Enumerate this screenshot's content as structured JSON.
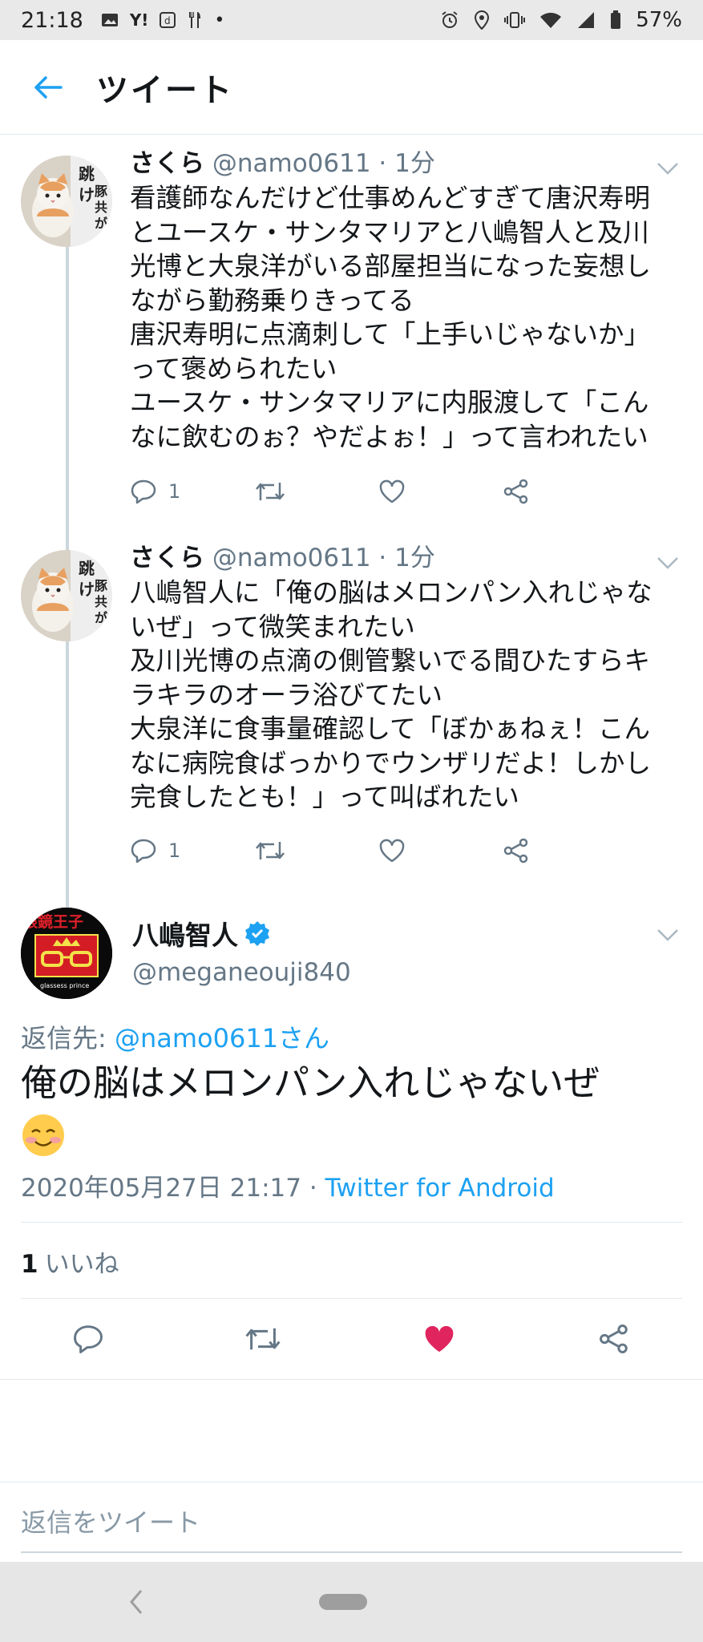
{
  "status_bar": {
    "time": "21:18",
    "battery": "57%"
  },
  "header": {
    "title": "ツイート"
  },
  "tweets": [
    {
      "name": "さくら",
      "handle": "@namo0611",
      "time": "· 1分",
      "text": "看護師なんだけど仕事めんどすぎて唐沢寿明\nとユースケ・サンタマリアと八嶋智人と及川\n光博と大泉洋がいる部屋担当になった妄想し\nながら勤務乗りきってる\n唐沢寿明に点滴刺して「上手いじゃないか」\nって褒められたい\nユースケ・サンタマリアに内服渡して「こん\nなに飲むのぉ？やだよぉ！」って言われたい",
      "reply_count": "1"
    },
    {
      "name": "さくら",
      "handle": "@namo0611",
      "time": "· 1分",
      "text": "八嶋智人に「俺の脳はメロンパン入れじゃな\nいぜ」って微笑まれたい\n及川光博の点滴の側管繋いでる間ひたすらキ\nラキラのオーラ浴びてたい\n大泉洋に食事量確認して「ぼかぁねぇ！こん\nなに病院食ばっかりでウンザリだよ！しかし\n完食したとも！」って叫ばれたい",
      "reply_count": "1"
    }
  ],
  "main_tweet": {
    "name": "八嶋智人",
    "handle": "@meganeouji840",
    "avatar_text": "眼鏡王子",
    "avatar_subtext": "glassess prince",
    "reply_to_label": "返信先: ",
    "reply_to_user": "@namo0611さん",
    "text": "俺の脳はメロンパン入れじゃないぜ",
    "emoji": "☺",
    "timestamp": "2020年05月27日 21:17 · ",
    "client": "Twitter for Android",
    "like_count": "1",
    "like_label": "いいね"
  },
  "reply": {
    "placeholder": "返信をツイート"
  },
  "colors": {
    "accent": "#1da1f2",
    "like": "#e0245e",
    "muted": "#657786"
  }
}
